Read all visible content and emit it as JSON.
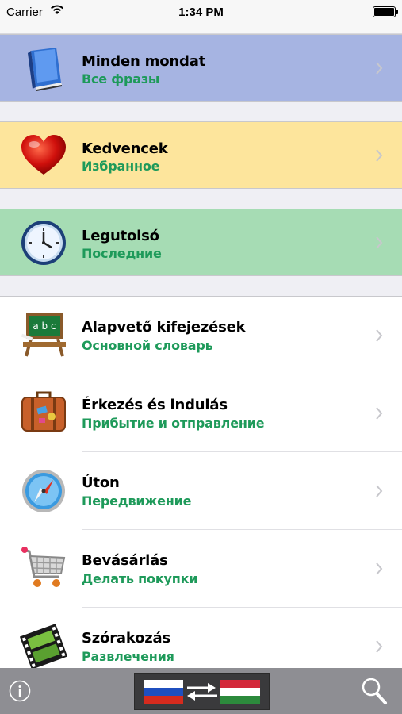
{
  "status": {
    "carrier": "Carrier",
    "time": "1:34 PM"
  },
  "categories": [
    {
      "title": "Minden mondat",
      "subtitle": "Все фразы",
      "bg": "#a6b4e2",
      "icon": "book-icon"
    },
    {
      "title": "Kedvencek",
      "subtitle": "Избранное",
      "bg": "#fde59c",
      "icon": "heart-icon"
    },
    {
      "title": "Legutolsó",
      "subtitle": "Последние",
      "bg": "#a6dcb4",
      "icon": "clock-icon"
    }
  ],
  "topics": [
    {
      "title": "Alapvető kifejezések",
      "subtitle": "Основной словарь",
      "icon": "chalkboard-icon",
      "board_text": "a b c"
    },
    {
      "title": "Érkezés és indulás",
      "subtitle": "Прибытие и отправление",
      "icon": "suitcase-icon"
    },
    {
      "title": "Úton",
      "subtitle": "Передвижение",
      "icon": "compass-icon"
    },
    {
      "title": "Bevásárlás",
      "subtitle": "Делать покупки",
      "icon": "shopping-cart-icon"
    },
    {
      "title": "Szórakozás",
      "subtitle": "Развлечения",
      "icon": "film-strip-icon"
    }
  ],
  "toolbar": {
    "info_icon": "info-icon",
    "language_switch_icon": "language-swap-icon",
    "search_icon": "search-icon",
    "colors": {
      "bar": "#8e8e93",
      "accent_green": "#1e9a5a"
    }
  }
}
